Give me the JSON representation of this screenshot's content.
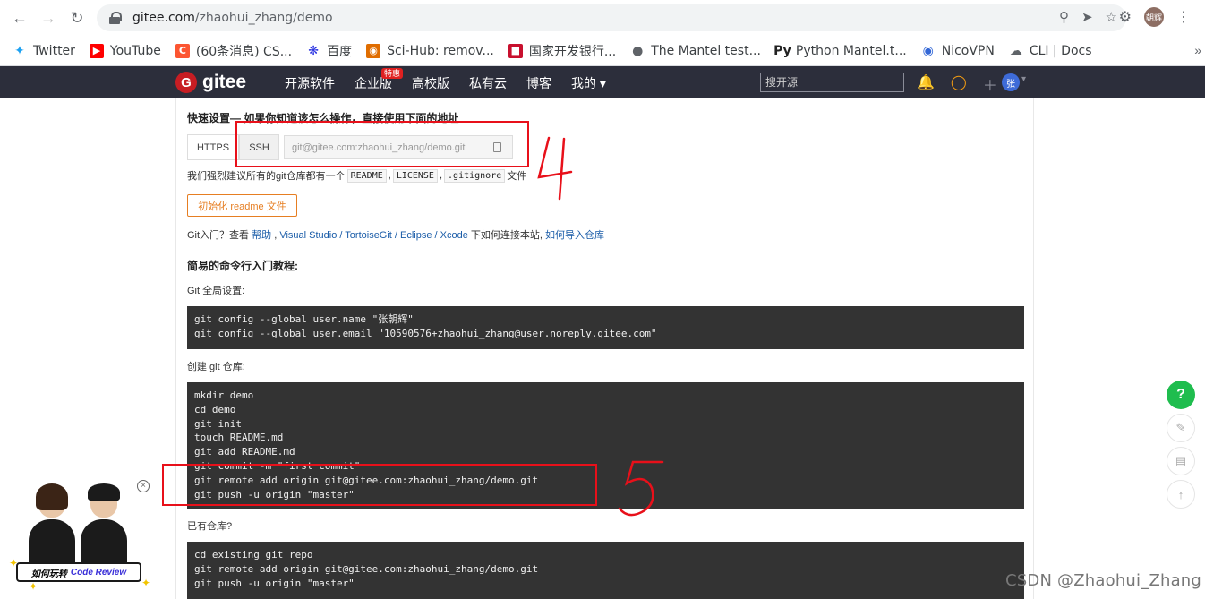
{
  "browser": {
    "url_host": "gitee.com",
    "url_path": "/zhaohui_zhang/demo",
    "profile_initials": "朝辉",
    "bookmarks": [
      {
        "label": "Twitter",
        "icon": "twitter-icon",
        "color": "#1da1f2"
      },
      {
        "label": "YouTube",
        "icon": "youtube-icon",
        "color": "#ff0000"
      },
      {
        "label": "(60条消息) CS...",
        "icon": "csdn-icon",
        "color": "#fc5531"
      },
      {
        "label": "百度",
        "icon": "baidu-icon",
        "color": "#2932e1"
      },
      {
        "label": "Sci-Hub: remov...",
        "icon": "scihub-icon",
        "color": "#e06d00"
      },
      {
        "label": "国家开发银行...",
        "icon": "cdb-icon",
        "color": "#c8102e"
      },
      {
        "label": "The Mantel test...",
        "icon": "globe-icon",
        "color": "#5f6368"
      },
      {
        "label": "Python Mantel.t...",
        "icon": "py-icon",
        "color": "#222222"
      },
      {
        "label": "NicoVPN",
        "icon": "nicovpn-icon",
        "color": "#3367d6"
      },
      {
        "label": "CLI | Docs",
        "icon": "cloud-icon",
        "color": "#5f6368"
      }
    ],
    "more_bookmarks": "»"
  },
  "gitee": {
    "logo_text": "gitee",
    "nav": [
      {
        "label": "开源软件"
      },
      {
        "label": "企业版",
        "badge": "特惠"
      },
      {
        "label": "高校版"
      },
      {
        "label": "私有云"
      },
      {
        "label": "博客"
      },
      {
        "label": "我的 ▾"
      }
    ],
    "search_placeholder": "搜开源",
    "user_avatar": "张"
  },
  "quick_setup": {
    "title": "快速设置— 如果你知道该怎么操作，直接使用下面的地址",
    "https_label": "HTTPS",
    "ssh_label": "SSH",
    "repo_url": "git@gitee.com:zhaohui_zhang/demo.git",
    "suggest_prefix": "我们强烈建议所有的git仓库都有一个",
    "files": [
      "README",
      "LICENSE",
      ".gitignore"
    ],
    "suggest_suffix": "文件",
    "init_button": "初始化 readme 文件",
    "intro_prefix": "Git入门？查看",
    "intro_help": "帮助",
    "intro_sep1": ",",
    "intro_tools": "Visual Studio / TortoiseGit / Eclipse / Xcode",
    "intro_mid": "下如何连接本站,",
    "intro_import": "如何导入仓库"
  },
  "tutorial": {
    "title": "简易的命令行入门教程:",
    "global_label": "Git 全局设置:",
    "global_lines": [
      "git config --global user.name \"张朝辉\"",
      "git config --global user.email \"10590576+zhaohui_zhang@user.noreply.gitee.com\""
    ],
    "create_label": "创建 git 仓库:",
    "create_lines": [
      "mkdir demo",
      "cd demo",
      "git init",
      "touch README.md",
      "git add README.md",
      "git commit -m \"first commit\"",
      "git remote add origin git@gitee.com:zhaohui_zhang/demo.git",
      "git push -u origin \"master\""
    ],
    "existing_label": "已有仓库?",
    "existing_lines": [
      "cd existing_git_repo",
      "git remote add origin git@gitee.com:zhaohui_zhang/demo.git",
      "git push -u origin \"master\""
    ]
  },
  "side": {
    "help": "?"
  },
  "ad": {
    "title": "如何玩转",
    "highlight": "Code Review",
    "close": "×"
  },
  "annotations": {
    "number_4": "4",
    "number_5": "5",
    "color": "#e8101a"
  },
  "watermark": "CSDN @Zhaohui_Zhang"
}
